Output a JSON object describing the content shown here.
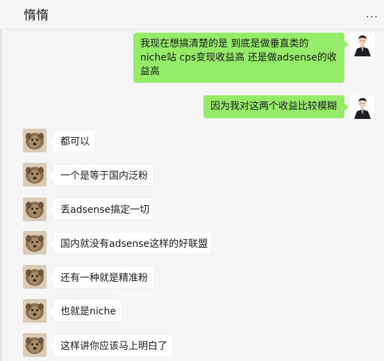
{
  "header": {
    "title": "惰惰",
    "more": "..."
  },
  "messages": [
    {
      "side": "me",
      "lines": [
        "我现在想搞清楚的是  到底是做垂直类的",
        "niche站  cps变现收益高  还是做adsense的收",
        "益高"
      ]
    },
    {
      "side": "me",
      "text": "因为我对这两个收益比较模糊"
    },
    {
      "side": "other",
      "text": "都可以"
    },
    {
      "side": "other",
      "text": "一个是等于国内泛粉"
    },
    {
      "side": "other",
      "text": "丢adsense搞定一切"
    },
    {
      "side": "other",
      "text": "国内就没有adsense这样的好联盟"
    },
    {
      "side": "other",
      "text": "还有一种就是精准粉"
    },
    {
      "side": "other",
      "text": "也就是niche"
    },
    {
      "side": "other",
      "text": "这样讲你应该马上明白了"
    }
  ],
  "icons": {
    "me_avatar": "man-in-suit-avatar",
    "other_avatar": "dog-avatar",
    "more": "more-dots-icon"
  }
}
